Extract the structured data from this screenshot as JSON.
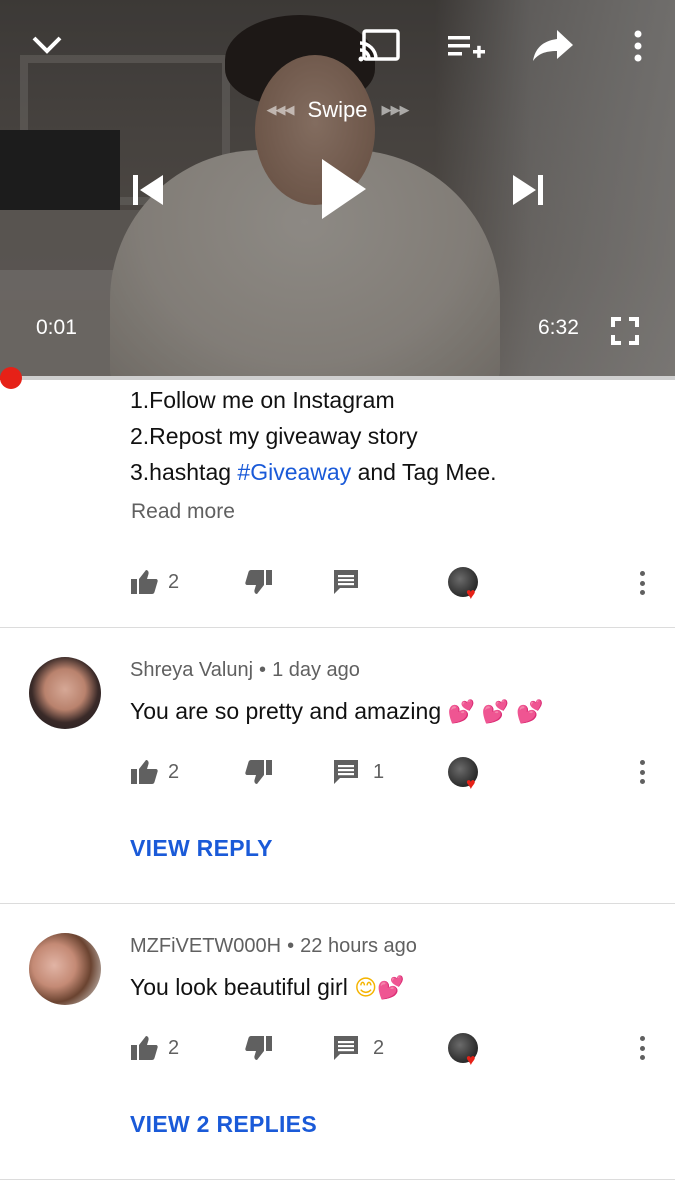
{
  "player": {
    "swipe_label": "Swipe",
    "current_time": "0:01",
    "duration": "6:32",
    "progress_fraction": 0.003,
    "accent_color": "#e62117"
  },
  "description": {
    "lines": [
      "1.Follow me on Instagram",
      "2.Repost my giveaway story"
    ],
    "line3_prefix": "3.hashtag ",
    "line3_tag": "#Giveaway",
    "line3_suffix": " and Tag Mee.",
    "read_more": "Read more",
    "like_count": "2"
  },
  "comments": [
    {
      "author": "Shreya Valunj",
      "age": "1 day ago",
      "text": "You are so pretty and amazing",
      "emoji": "💕 💕 💕",
      "likes": "2",
      "replies": "1",
      "view_replies_label": "VIEW REPLY"
    },
    {
      "author": "MZFiVETW000H",
      "age": "22 hours ago",
      "text": "You look beautiful girl",
      "emoji_smile": "😊",
      "emoji": "💕",
      "likes": "2",
      "replies": "2",
      "view_replies_label": "VIEW 2 REPLIES"
    }
  ],
  "separator": "•",
  "colors": {
    "link": "#1a5ad8",
    "secondary_text": "#606060",
    "heart": "#e62117"
  }
}
